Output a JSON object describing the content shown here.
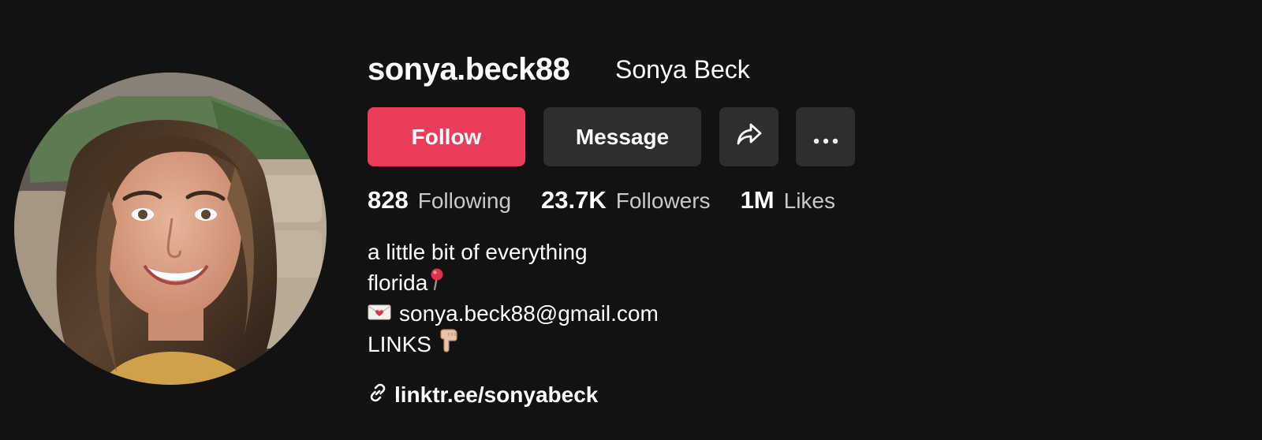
{
  "profile": {
    "username": "sonya.beck88",
    "nickname": "Sonya Beck",
    "avatar_alt": "profile photo"
  },
  "actions": {
    "follow_label": "Follow",
    "message_label": "Message",
    "share_icon": "share-arrow-icon",
    "more_icon": "more-dots-icon",
    "follow_color": "#ea3d5b",
    "secondary_color": "#2e2e2e"
  },
  "stats": [
    {
      "value": "828",
      "label": "Following"
    },
    {
      "value": "23.7K",
      "label": "Followers"
    },
    {
      "value": "1M",
      "label": "Likes"
    }
  ],
  "bio": {
    "line1": "a little bit of everything",
    "line2": "florida",
    "line2_icon": "round-pushpin-icon",
    "line3_icon": "love-letter-icon",
    "line3": "sonya.beck88@gmail.com",
    "line4": "LINKS",
    "line4_icon": "pointing-down-hand-icon"
  },
  "link": {
    "icon": "link-chain-icon",
    "text": "linktr.ee/sonyabeck"
  },
  "theme": {
    "background": "#121212",
    "text_primary": "#ffffff",
    "text_secondary": "#c9c9c9"
  }
}
